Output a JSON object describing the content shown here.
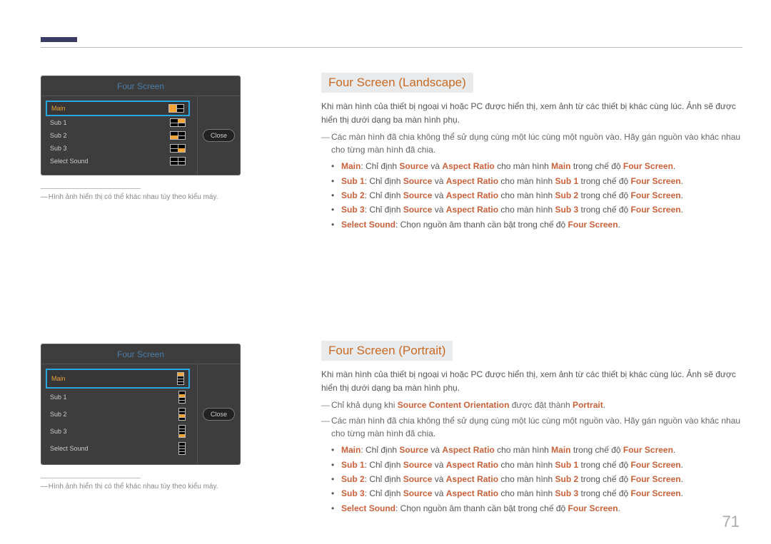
{
  "page_number": "71",
  "panel": {
    "title": "Four Screen",
    "rows": [
      "Main",
      "Sub 1",
      "Sub 2",
      "Sub 3",
      "Select Sound"
    ],
    "close": "Close"
  },
  "caption": "Hình ảnh hiển thị có thể khác nhau tùy theo kiểu máy.",
  "landscape": {
    "title": "Four Screen (Landscape)",
    "intro": "Khi màn hình của thiết bị ngoại vi hoặc PC được hiển thị, xem ảnh từ các thiết bị khác cùng lúc. Ảnh sẽ được hiển thị dưới dạng ba màn hình phụ.",
    "note1": "Các màn hình đã chia không thể sử dụng cùng một lúc cùng một nguồn vào. Hãy gán nguồn vào khác nhau cho từng màn hình đã chia.",
    "items": {
      "main": {
        "label": "Main",
        "t1": ": Chỉ định ",
        "k1": "Source",
        "t2": " và ",
        "k2": "Aspect Ratio",
        "t3": " cho màn hình ",
        "k3": "Main",
        "t4": " trong chế độ ",
        "k4": "Four Screen",
        "t5": "."
      },
      "sub1": {
        "label": "Sub 1",
        "t1": ": Chỉ định ",
        "k1": "Source",
        "t2": " và ",
        "k2": "Aspect Ratio",
        "t3": " cho màn hình ",
        "k3": "Sub 1",
        "t4": " trong chế độ ",
        "k4": "Four Screen",
        "t5": "."
      },
      "sub2": {
        "label": "Sub 2",
        "t1": ": Chỉ định ",
        "k1": "Source",
        "t2": " và ",
        "k2": "Aspect Ratio",
        "t3": " cho màn hình ",
        "k3": "Sub 2",
        "t4": " trong chế độ ",
        "k4": "Four Screen",
        "t5": "."
      },
      "sub3": {
        "label": "Sub 3",
        "t1": ": Chỉ định ",
        "k1": "Source",
        "t2": " và ",
        "k2": "Aspect Ratio",
        "t3": " cho màn hình ",
        "k3": "Sub 3",
        "t4": " trong chế độ ",
        "k4": "Four Screen",
        "t5": "."
      },
      "sound": {
        "label": "Select Sound",
        "t1": ": Chọn nguồn âm thanh cần bật trong chế độ ",
        "k1": "Four Screen",
        "t2": "."
      }
    }
  },
  "portrait": {
    "title": "Four Screen (Portrait)",
    "intro": "Khi màn hình của thiết bị ngoại vi hoặc PC được hiển thị, xem ảnh từ các thiết bị khác cùng lúc. Ảnh sẽ được hiển thị dưới dạng ba màn hình phụ.",
    "note0a": "Chỉ khả dụng khi ",
    "note0k": "Source Content Orientation",
    "note0b": " được đặt thành ",
    "note0k2": "Portrait",
    "note0c": ".",
    "note1": "Các màn hình đã chia không thể sử dụng cùng một lúc cùng một nguồn vào. Hãy gán nguồn vào khác nhau cho từng màn hình đã chia.",
    "items": {
      "main": {
        "label": "Main",
        "t1": ": Chỉ định ",
        "k1": "Source",
        "t2": " và ",
        "k2": "Aspect Ratio",
        "t3": " cho màn hình ",
        "k3": "Main",
        "t4": " trong chế độ ",
        "k4": "Four Screen",
        "t5": "."
      },
      "sub1": {
        "label": "Sub 1",
        "t1": ": Chỉ định ",
        "k1": "Source",
        "t2": " và ",
        "k2": "Aspect Ratio",
        "t3": " cho màn hình ",
        "k3": "Sub 1",
        "t4": " trong chế độ ",
        "k4": "Four Screen",
        "t5": "."
      },
      "sub2": {
        "label": "Sub 2",
        "t1": ": Chỉ định ",
        "k1": "Source",
        "t2": " và ",
        "k2": "Aspect Ratio",
        "t3": " cho màn hình ",
        "k3": "Sub 2",
        "t4": " trong chế độ ",
        "k4": "Four Screen",
        "t5": "."
      },
      "sub3": {
        "label": "Sub 3",
        "t1": ": Chỉ định ",
        "k1": "Source",
        "t2": " và ",
        "k2": "Aspect Ratio",
        "t3": " cho màn hình ",
        "k3": "Sub 3",
        "t4": " trong chế độ ",
        "k4": "Four Screen",
        "t5": "."
      },
      "sound": {
        "label": "Select Sound",
        "t1": ": Chọn nguồn âm thanh cần bật trong chế độ ",
        "k1": "Four Screen",
        "t2": "."
      }
    }
  }
}
